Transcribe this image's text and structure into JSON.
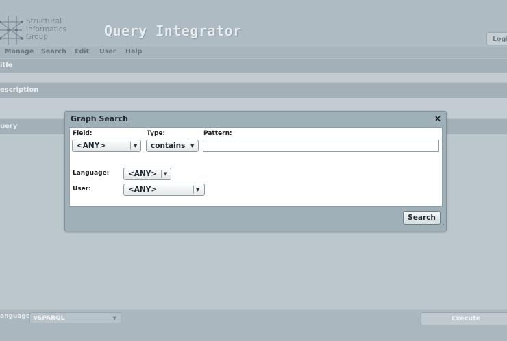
{
  "header": {
    "logo_lines": [
      "Structural",
      "Informatics",
      "Group"
    ],
    "app_title": "Query Integrator",
    "login_label": "Logi"
  },
  "menu": [
    "Manage",
    "Search",
    "Edit",
    "User",
    "Help"
  ],
  "sections": {
    "title": "itle",
    "description": "escription",
    "query": "uery"
  },
  "footer": {
    "language_label": "anguage",
    "language_value": "vSPARQL",
    "execute_label": "Execute"
  },
  "dialog": {
    "title": "Graph Search",
    "close_glyph": "×",
    "field_label": "Field:",
    "field_value": "<ANY>",
    "type_label": "Type:",
    "type_value": "contains",
    "pattern_label": "Pattern:",
    "pattern_value": "",
    "language_label": "Language:",
    "language_value": "<ANY>",
    "user_label": "User:",
    "user_value": "<ANY>",
    "search_label": "Search"
  },
  "icons": {
    "logo": "structural-network-logo",
    "dropdown": "triangle-down",
    "resize": "resize-grip"
  }
}
